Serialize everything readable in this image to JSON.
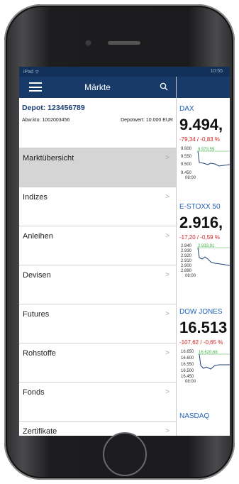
{
  "status": {
    "left": "iPad ᯤ",
    "time": "10:55"
  },
  "nav": {
    "title": "Märkte"
  },
  "depot": {
    "title": "Depot: 123456789",
    "abw": "Abw.kto: 1002003456",
    "wert": "Depotwert: 10.000 EUR"
  },
  "menu": [
    {
      "label": "Marktübersicht",
      "active": true
    },
    {
      "label": "Indizes"
    },
    {
      "label": "Anleihen"
    },
    {
      "label": "Devisen"
    },
    {
      "label": "Futures"
    },
    {
      "label": "Rohstoffe"
    },
    {
      "label": "Fonds"
    },
    {
      "label": "Zertifikate"
    }
  ],
  "quotes": [
    {
      "name": "DAX",
      "value": "9.494,",
      "change": "-79,34 / -0,83 %",
      "ticks": [
        "9.600",
        "9.550",
        "9.500",
        "9.450"
      ],
      "ref": "9.573,59",
      "time": "08:00"
    },
    {
      "name": "E-STOXX 50",
      "value": "2.916,",
      "change": "-17,20 / -0,59 %",
      "ticks": [
        "2.940",
        "2.930",
        "2.920",
        "2.910",
        "2.900",
        "2.890"
      ],
      "ref": "2.933,91",
      "time": "08:00"
    },
    {
      "name": "DOW JONES",
      "value": "16.513",
      "change": "-107,62 / -0,65 %",
      "ticks": [
        "16.650",
        "16.600",
        "16.550",
        "16.500",
        "16.450"
      ],
      "ref": "16.620,68",
      "time": "08:00"
    },
    {
      "name": "NASDAQ"
    }
  ],
  "colors": {
    "navbar": "#183a68",
    "accent": "#2262b8",
    "negative": "#d42020",
    "reference": "#3cb043"
  }
}
